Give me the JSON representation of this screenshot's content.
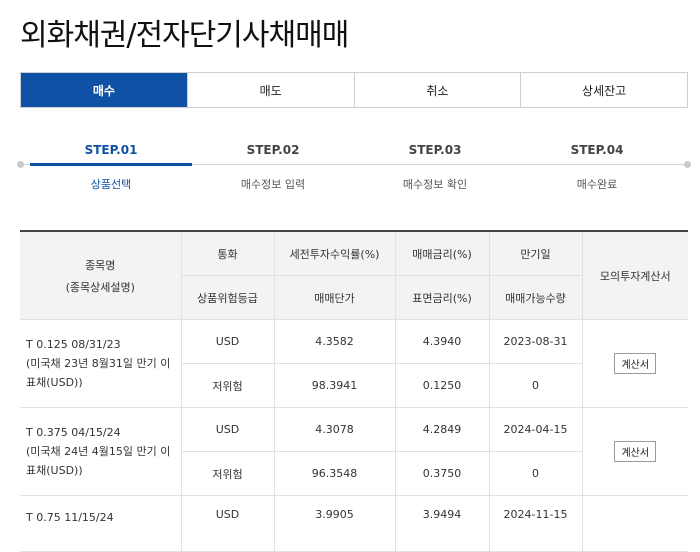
{
  "page": {
    "title": "외화채권/전자단기사채매매"
  },
  "tabs": [
    {
      "label": "매수",
      "active": true
    },
    {
      "label": "매도"
    },
    {
      "label": "취소"
    },
    {
      "label": "상세잔고"
    }
  ],
  "steps": [
    {
      "num": "STEP.01",
      "label": "상품선택",
      "active": true
    },
    {
      "num": "STEP.02",
      "label": "매수정보 입력"
    },
    {
      "num": "STEP.03",
      "label": "매수정보 확인"
    },
    {
      "num": "STEP.04",
      "label": "매수완료"
    }
  ],
  "table": {
    "headers": {
      "name_line1": "종목명",
      "name_line2": "(종목상세설명)",
      "currency": "통화",
      "risk": "상품위험등급",
      "pre_tax_yield": "세전투자수익률(%)",
      "unit_price": "매매단가",
      "trade_rate": "매매금리(%)",
      "coupon_rate": "표면금리(%)",
      "maturity": "만기일",
      "tradable_qty": "매매가능수량",
      "calculator": "모의투자계산서"
    },
    "rows": [
      {
        "name": "T 0.125 08/31/23",
        "desc": "(미국채 23년 8월31일 만기 이표채(USD))",
        "currency": "USD",
        "risk": "저위험",
        "pre_tax_yield": "4.3582",
        "unit_price": "98.3941",
        "trade_rate": "4.3940",
        "coupon_rate": "0.1250",
        "maturity": "2023-08-31",
        "tradable_qty": "0",
        "button": "계산서"
      },
      {
        "name": "T 0.375 04/15/24",
        "desc": "(미국채 24년 4월15일 만기 이표채(USD))",
        "currency": "USD",
        "risk": "저위험",
        "pre_tax_yield": "4.3078",
        "unit_price": "96.3548",
        "trade_rate": "4.2849",
        "coupon_rate": "0.3750",
        "maturity": "2024-04-15",
        "tradable_qty": "0",
        "button": "계산서"
      },
      {
        "name": "T 0.75 11/15/24",
        "desc": "",
        "currency": "USD",
        "risk": "",
        "pre_tax_yield": "3.9905",
        "unit_price": "",
        "trade_rate": "3.9494",
        "coupon_rate": "",
        "maturity": "2024-11-15",
        "tradable_qty": "",
        "button": ""
      }
    ]
  }
}
